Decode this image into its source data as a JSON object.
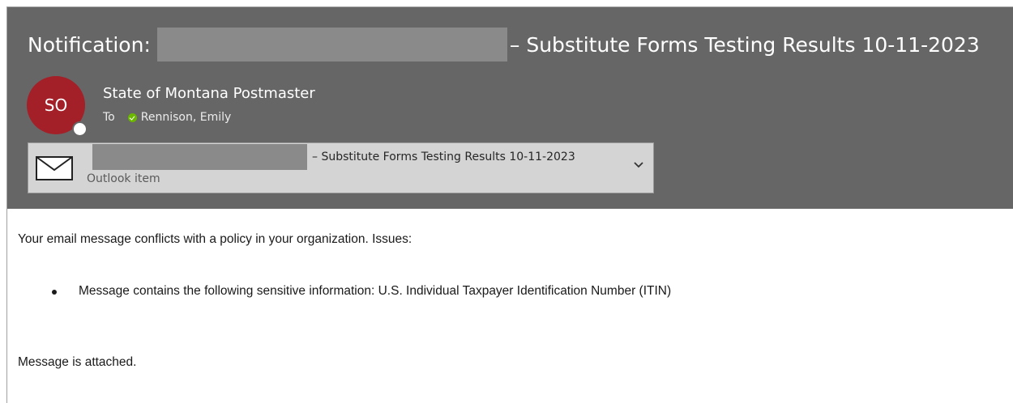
{
  "message": {
    "subject_prefix": "Notification:",
    "subject_suffix": "– Substitute Forms Testing Results 10-11-2023",
    "avatar_initials": "SO",
    "sender_name": "State of Montana Postmaster",
    "to_label": "To",
    "recipient": "Rennison, Emily"
  },
  "attachment": {
    "title_suffix": "– Substitute Forms Testing Results 10-11-2023",
    "type_label": "Outlook item",
    "icon": "envelope-icon"
  },
  "body": {
    "intro": "Your email message conflicts with a policy in your organization. Issues:",
    "issues": [
      "Message contains the following sensitive information: U.S. Individual Taxpayer Identification Number (ITIN)"
    ],
    "closing": "Message is attached."
  },
  "colors": {
    "header_bg": "#666666",
    "avatar_bg": "#a32029",
    "status_green": "#6bb700",
    "attachment_bg": "#d4d4d4"
  }
}
